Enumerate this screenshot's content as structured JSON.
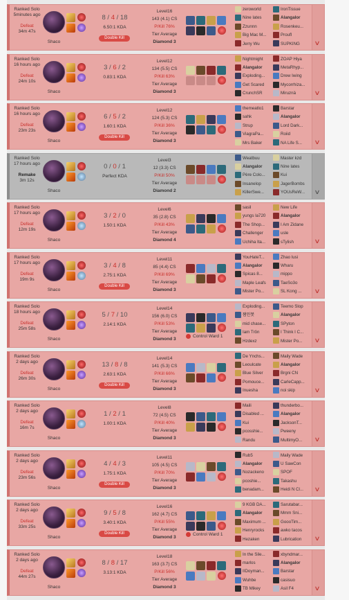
{
  "matches": [
    {
      "queue": "Ranked Solo",
      "ago": "5minutes ago",
      "result": "Defeat",
      "duration": "34m 47s",
      "champion": "Shaco",
      "kills": "8",
      "deaths": "4",
      "assists": "18",
      "kda": "6.50:1 KDA",
      "multikill": "Double Kill",
      "level": "Level16",
      "cs": "143 (4.1) CS",
      "pkill": "P/Kill 76%",
      "tier_label": "Tier Average",
      "tier": "Diamond 3",
      "control_ward": "",
      "remake": false,
      "rune2": "purple",
      "team1": [
        "zeroworld",
        "Nine lates",
        "Zzunnn",
        "Big Mac M...",
        "Jerry Wu"
      ],
      "team2": [
        "IronTissue",
        "Alangalor",
        "Rosenkeu...",
        "Proufl",
        "SUPKING"
      ]
    },
    {
      "queue": "Ranked Solo",
      "ago": "16 hours ago",
      "result": "Defeat",
      "duration": "24m 10s",
      "champion": "Shaco",
      "kills": "3",
      "deaths": "6",
      "assists": "2",
      "kda": "0.83:1 KDA",
      "multikill": "",
      "level": "Level12",
      "cs": "134 (5.5) CS",
      "pkill": "P/Kill 63%",
      "tier_label": "Tier Average",
      "tier": "Diamond 3",
      "control_ward": "",
      "remake": false,
      "rune2": "purple",
      "team1": [
        "Nightmight",
        "Alangalor",
        "Exploding...",
        "Get Scared",
        "CrunchSR"
      ],
      "team2": [
        "ZOAP Hiya",
        "MetaRhyp...",
        "Drew Iwing",
        "Mycorrhiza...",
        "Miruznä"
      ]
    },
    {
      "queue": "Ranked Solo",
      "ago": "16 hours ago",
      "result": "Defeat",
      "duration": "23m 23s",
      "champion": "Shaco",
      "kills": "6",
      "deaths": "5",
      "assists": "2",
      "kda": "1.60:1 KDA",
      "multikill": "Double Kill",
      "level": "Level12",
      "cs": "124 (5.3) CS",
      "pkill": "P/Kill 36%",
      "tier_label": "Tier Average",
      "tier": "Diamond 3",
      "control_ward": "",
      "remake": false,
      "rune2": "purple",
      "team1": [
        "themeatlo1",
        "sahk",
        "Strup",
        "ViagraPa...",
        "Mrs Baker"
      ],
      "team2": [
        "Barstar",
        "Alangalor",
        "Lord Dark...",
        "Roiid",
        "NA Life S..."
      ]
    },
    {
      "queue": "Ranked Solo",
      "ago": "17 hours ago",
      "result": "Remake",
      "duration": "3m 12s",
      "champion": "Shaco",
      "kills": "0",
      "deaths": "0",
      "assists": "1",
      "kda": "Perfect KDA",
      "multikill": "",
      "level": "Level3",
      "cs": "12 (3.3) CS",
      "pkill": "P/Kill 50%",
      "tier_label": "Tier Average",
      "tier": "Diamond 2",
      "control_ward": "",
      "remake": true,
      "rune2": "blue",
      "team1": [
        "Weatbuu",
        "Alangalor",
        "Père Colo...",
        "Insanelop",
        "KillerSwe..."
      ],
      "team2": [
        "Master kzd",
        "Nine lates",
        "Kui",
        "JagerBombs",
        "YOUsReW..."
      ]
    },
    {
      "queue": "Ranked Solo",
      "ago": "17 hours ago",
      "result": "Defeat",
      "duration": "12m 19s",
      "champion": "Shaco",
      "kills": "3",
      "deaths": "2",
      "assists": "0",
      "kda": "1.50:1 KDA",
      "multikill": "",
      "level": "Level6",
      "cs": "35 (2.8) CS",
      "pkill": "P/Kill 43%",
      "tier_label": "Tier Average",
      "tier": "Diamond 4",
      "control_ward": "",
      "remake": false,
      "rune2": "blue",
      "team1": [
        "sasil",
        "yungs la720",
        "The Shop...",
        "Challenger",
        "Uchiha Ita..."
      ],
      "team2": [
        "New Life",
        "Alangalor",
        "I Am Zidane",
        "usle",
        "sTylish"
      ]
    },
    {
      "queue": "Ranked Solo",
      "ago": "17 hours ago",
      "result": "Defeat",
      "duration": "19m 9s",
      "champion": "Shaco",
      "kills": "3",
      "deaths": "4",
      "assists": "8",
      "kda": "2.75:1 KDA",
      "multikill": "Double Kill",
      "level": "Level11",
      "cs": "85 (4.4) CS",
      "pkill": "P/Kill 69%",
      "tier_label": "Tier Average",
      "tier": "Diamond 3",
      "control_ward": "",
      "remake": false,
      "rune2": "blue",
      "team1": [
        "YouHateT...",
        "Alangalor",
        "Spicas 8...",
        "Maple Leafs",
        "Mister Po..."
      ],
      "team2": [
        "Zhao lusi",
        "Wharu",
        "mippo",
        "TaeSo3o",
        "SL Kong ..."
      ]
    },
    {
      "queue": "Ranked Solo",
      "ago": "18 hours ago",
      "result": "Defeat",
      "duration": "25m 58s",
      "champion": "Shaco",
      "kills": "5",
      "deaths": "7",
      "assists": "10",
      "kda": "2.14:1 KDA",
      "multikill": "",
      "level": "Level14",
      "cs": "156 (6.0) CS",
      "pkill": "P/Kill 53%",
      "tier_label": "Tier Average",
      "tier": "Diamond 3",
      "control_ward": "Control Ward 1",
      "remake": false,
      "rune2": "purple",
      "team1": [
        "Exploding...",
        "잼민봇",
        "mid chase...",
        "Iam Trôn",
        "Hzdexz"
      ],
      "team2": [
        "Teemo Slop",
        "Alangalor",
        "SPyton",
        "I Think I C...",
        "Mister Po..."
      ]
    },
    {
      "queue": "Ranked Solo",
      "ago": "2 days ago",
      "result": "Defeat",
      "duration": "26m 30s",
      "champion": "Shaco",
      "kills": "13",
      "deaths": "8",
      "assists": "8",
      "kda": "2.63:1 KDA",
      "multikill": "Double Kill",
      "level": "Level14",
      "cs": "141 (5.3) CS",
      "pkill": "P/Kill 66%",
      "tier_label": "Tier Average",
      "tier": "Diamond 3",
      "control_ward": "",
      "remake": false,
      "rune2": "purple",
      "team1": [
        "De Ynchs...",
        "Leoulcate",
        "Blue Silver",
        "Pomouce...",
        "Inuesha"
      ],
      "team2": [
        "Maily Wade",
        "Alangalor",
        "Brgni CN",
        "CarleCapp...",
        "noi skip"
      ]
    },
    {
      "queue": "Ranked Solo",
      "ago": "2 days ago",
      "result": "Defeat",
      "duration": "16m 7s",
      "champion": "Shaco",
      "kills": "1",
      "deaths": "2",
      "assists": "1",
      "kda": "1.00:1 KDA",
      "multikill": "",
      "level": "Level8",
      "cs": "72 (4.5) CS",
      "pkill": "P/Kill 40%",
      "tier_label": "Tier Average",
      "tier": "Diamond 3",
      "control_ward": "",
      "remake": false,
      "rune2": "blue",
      "team1": [
        "Maili",
        "Disabled ...",
        "Kui",
        "pcosshie...",
        "Randu"
      ],
      "team2": [
        "thunderbo...",
        "Alangalor",
        "JacksonT...",
        "Pweeny",
        "MultimyO..."
      ]
    },
    {
      "queue": "Ranked Solo",
      "ago": "2 days ago",
      "result": "Defeat",
      "duration": "23m 56s",
      "champion": "Shaco",
      "kills": "4",
      "deaths": "4",
      "assists": "3",
      "kda": "1.75:1 KDA",
      "multikill": "Double Kill",
      "level": "Level11",
      "cs": "105 (4.5) CS",
      "pkill": "P/Kill 70%",
      "tier_label": "Tier Average",
      "tier": "Diamond 3",
      "control_ward": "",
      "remake": false,
      "rune2": "purple",
      "team1": [
        "Rub5",
        "Alangalor",
        "Nozackeno",
        "pcoshie...",
        "benadam..."
      ],
      "team2": [
        "Maily Wade",
        "U SawCon",
        "SPOF",
        "Takashu",
        "Heidi N Cl..."
      ]
    },
    {
      "queue": "Ranked Solo",
      "ago": "2 days ago",
      "result": "Defeat",
      "duration": "33m 25s",
      "champion": "Shaco",
      "kills": "9",
      "deaths": "5",
      "assists": "8",
      "kda": "3.40:1 KDA",
      "multikill": "Double Kill",
      "level": "Level16",
      "cs": "162 (4.7) CS",
      "pkill": "P/Kill 55%",
      "tier_label": "Tier Average",
      "tier": "Diamond 3",
      "control_ward": "Control Ward 1",
      "remake": false,
      "rune2": "purple",
      "team1": [
        "9 KGB DA...",
        "Alangalor",
        "Maximum ...",
        "Henryrocks",
        "Hezaken"
      ],
      "team2": [
        "Sarutabar...",
        "Mmm Sni...",
        "GoooTim...",
        "awko tacos",
        "Lubrication"
      ]
    },
    {
      "queue": "Ranked Solo",
      "ago": "2 days ago",
      "result": "Defeat",
      "duration": "44m 27s",
      "champion": "Shaco",
      "kills": "8",
      "deaths": "8",
      "assists": "17",
      "kda": "3.13:1 KDA",
      "multikill": "",
      "level": "Level18",
      "cs": "163 (3.7) CS",
      "pkill": "P/Kill 56%",
      "tier_label": "Tier Average",
      "tier": "Diamond 3",
      "control_ward": "",
      "remake": false,
      "rune2": "purple",
      "team1": [
        "In the Sile...",
        "marlos",
        "IIDoyman...",
        "Wuhbe",
        "TB Mikey"
      ],
      "team2": [
        "xbyndmar...",
        "Alangalor",
        "Barstar",
        "casisuo",
        "Asil F4"
      ]
    }
  ],
  "colors": {
    "defeat_bg": "#e8a7a4",
    "remake_bg": "#b9b9b9",
    "defeat_text": "#c9302c",
    "badge": "#d94a45"
  }
}
